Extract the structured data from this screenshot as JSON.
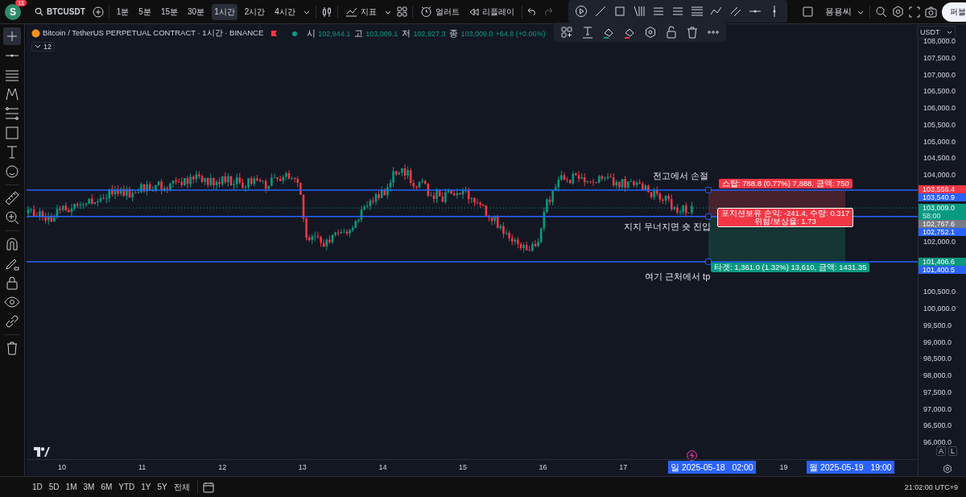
{
  "top_toolbar": {
    "avatar_letter": "S",
    "notification_count": "11",
    "symbol": "BTCUSDT",
    "intervals": [
      {
        "label": "1분",
        "selected": false
      },
      {
        "label": "5분",
        "selected": false
      },
      {
        "label": "15분",
        "selected": false
      },
      {
        "label": "30분",
        "selected": false
      },
      {
        "label": "1시간",
        "selected": true
      },
      {
        "label": "2시간",
        "selected": false
      },
      {
        "label": "4시간",
        "selected": false
      }
    ],
    "indicators_label": "지표",
    "alert_label": "얼러트",
    "replay_label": "리플레이",
    "user_name": "용용씨",
    "publish_button": "퍼블"
  },
  "legend": {
    "title": "Bitcoin / TetherUS PERPETUAL CONTRACT · 1시간 · BINANCE",
    "ohlc": [
      {
        "label": "시",
        "value": "102,944.1"
      },
      {
        "label": "고",
        "value": "103,009.1"
      },
      {
        "label": "저",
        "value": "102,927.3"
      },
      {
        "label": "종",
        "value": "103,009.0"
      }
    ],
    "change": "+64.8 (+0.06%)",
    "indicator_count": "12"
  },
  "currency": "USDT",
  "price_axis": {
    "ticks": [
      "108,000.0",
      "107,500.0",
      "107,000.0",
      "106,500.0",
      "106,000.0",
      "105,500.0",
      "105,000.0",
      "104,500.0",
      "104,000.0",
      "102,000.0",
      "100,500.0",
      "100,000.0",
      "99,500.0",
      "99,000.0",
      "98,500.0",
      "98,000.0",
      "97,500.0",
      "97,000.0",
      "96,500.0",
      "96,000.0"
    ],
    "badges": [
      {
        "value": "103,556.4",
        "color": "#f23645"
      },
      {
        "value": "103,540.9",
        "color": "#2962ff"
      },
      {
        "value": "103,009.0",
        "sub": "58:00",
        "color": "#089981"
      },
      {
        "value": "102,767.6",
        "color": "#787b86"
      },
      {
        "value": "102,752.1",
        "color": "#2962ff"
      },
      {
        "value": "101,406.6",
        "color": "#089981"
      },
      {
        "value": "101,400.5",
        "color": "#2962ff"
      }
    ],
    "scale_buttons": [
      "A",
      "L"
    ]
  },
  "annotations": [
    {
      "kind": "stop",
      "text": "전고에서 손절"
    },
    {
      "kind": "entry",
      "text": "지지 무너지면 숏 진입"
    },
    {
      "kind": "target",
      "text": "여기 근처에서 tp"
    }
  ],
  "position": {
    "stop_label": "스탑: 788.8 (0.77%) 7,888, 금액: 750",
    "pnl_label": "포지션보유 손익: -241.4, 수량: 0.317",
    "ratio_label": "위험/보상율: 1.73",
    "target_label": "타겟: 1,361.0 (1.32%) 13,610, 금액: 1431.35"
  },
  "time_axis": {
    "days": [
      "10",
      "11",
      "12",
      "13",
      "14",
      "15",
      "16",
      "17",
      "19"
    ],
    "cursor_labels": [
      "일 2025-05-18   02:00",
      "월 2025-05-19   19:00"
    ]
  },
  "bottom_bar": {
    "ranges": [
      "1D",
      "5D",
      "1M",
      "3M",
      "6M",
      "YTD",
      "1Y",
      "5Y",
      "전체"
    ],
    "clock": "21:02:00 UTC+9"
  }
}
